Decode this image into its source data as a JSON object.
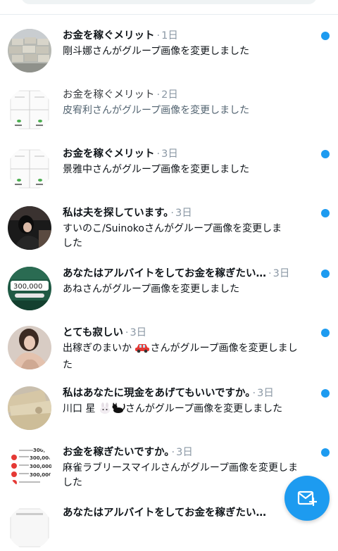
{
  "conversations": [
    {
      "title": "お金を稼ぐメリット",
      "separator": "·",
      "time": "1日",
      "message": "剛斗娜さんがグループ画像を変更しました",
      "unread": true,
      "avatar": "paper-stack-avatar"
    },
    {
      "title": "お金を稼ぐメリット",
      "separator": "·",
      "time": "2日",
      "message": "皮宥利さんがグループ画像を変更しました",
      "unread": false,
      "avatar": "grid-card-avatar"
    },
    {
      "title": "お金を稼ぐメリット",
      "separator": "·",
      "time": "3日",
      "message": "景雅中さんがグループ画像を変更しました",
      "unread": true,
      "avatar": "grid-card-avatar"
    },
    {
      "title": "私は夫を探しています。",
      "separator": "·",
      "time": "3日",
      "message_lines": [
        "すいのこ/Suinokoさんがグループ画像を変更しま",
        "した"
      ],
      "unread": true,
      "avatar": "person-photo-avatar"
    },
    {
      "title": "あなたはアルバイトをしてお金を稼ぎたい…",
      "separator": "·",
      "time": "3日",
      "message": "あねさんがグループ画像を変更しました",
      "unread": true,
      "avatar": "balance-avatar",
      "avatar_text": "300,000"
    },
    {
      "title": "とても寂しい",
      "separator": "·",
      "time": "3日",
      "message_lines": [
        "出稼ぎのまいか",
        "さんがグループ画像を変更しまし",
        "た"
      ],
      "unread": true,
      "avatar": "woman-photo-avatar",
      "emoji": "car"
    },
    {
      "title": "私はあなたに現金をあげてもいいですか。",
      "separator": "·",
      "time": "3日",
      "message_parts": [
        "川口 星",
        "さんがグループ画像を変更しました"
      ],
      "unread": true,
      "avatar": "cash-photo-avatar",
      "emojis": [
        "rabbit",
        "black-cat"
      ]
    },
    {
      "title": "お金を稼ぎたいですか。",
      "separator": "·",
      "time": "3日",
      "message_lines": [
        "麻雀ラブリースマイルさんがグループ画像を変更しま",
        "した"
      ],
      "unread": true,
      "avatar": "amount-list-avatar",
      "avatar_text": [
        "300,",
        "300,000-",
        "300,000-",
        "300,000-"
      ]
    },
    {
      "title": "あなたはアルバイトをしてお金を稼ぎたい…",
      "separator": "·",
      "time": "",
      "message": "",
      "unread": false,
      "avatar": "partial-avatar"
    }
  ],
  "fab": {
    "icon": "new-message-icon"
  },
  "colors": {
    "accent": "#1d9bf0",
    "muted": "#8b98a5",
    "text": "#0f1419"
  }
}
